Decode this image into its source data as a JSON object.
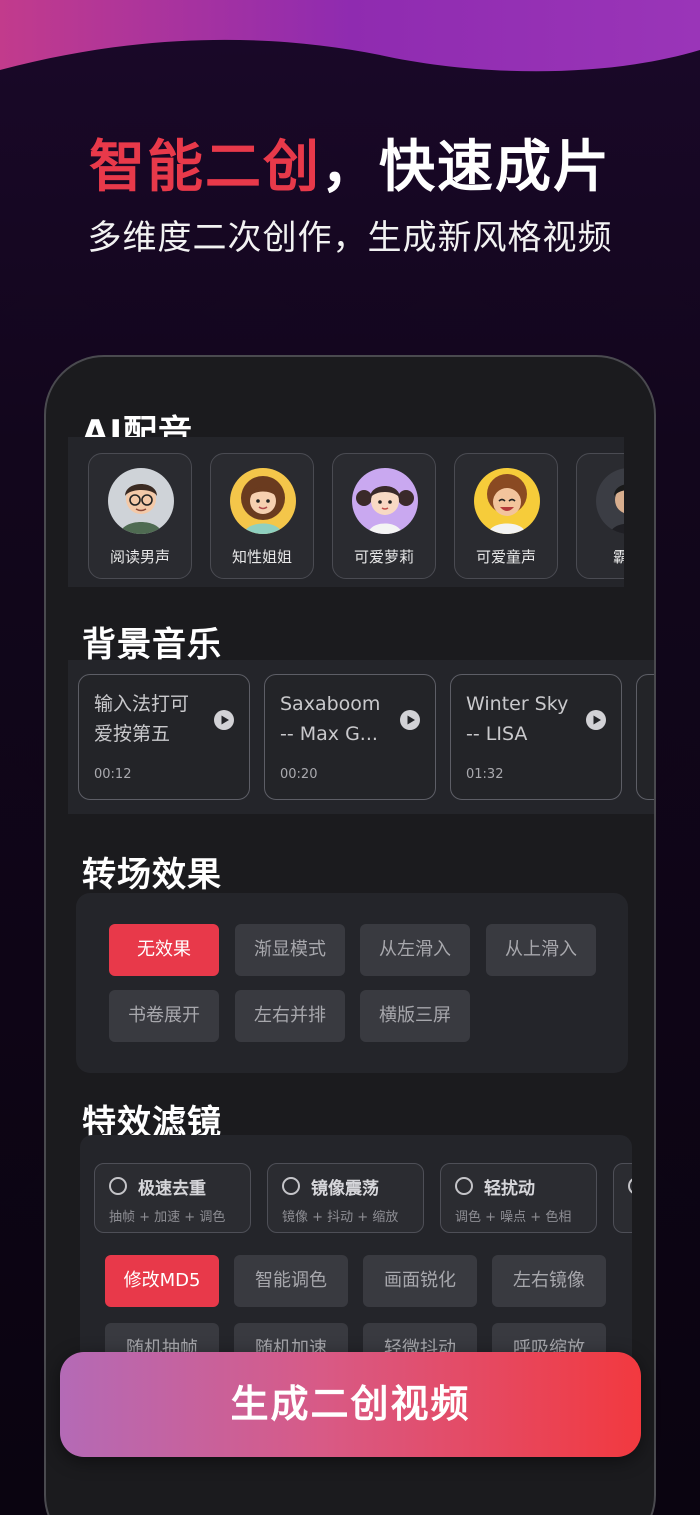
{
  "colors": {
    "accent": "#e8394a",
    "panel": "#24252a",
    "chip": "#393a40"
  },
  "hero": {
    "title_red": "智能二创",
    "title_white": "，快速成片",
    "subtitle": "多维度二次创作，生成新风格视频"
  },
  "voices": {
    "title": "AI配音",
    "items": [
      {
        "label": "阅读男声",
        "icon": "avatar-man-glasses"
      },
      {
        "label": "知性姐姐",
        "icon": "avatar-woman-curly"
      },
      {
        "label": "可爱萝莉",
        "icon": "avatar-girl-pigtails"
      },
      {
        "label": "可爱童声",
        "icon": "avatar-boy-curly"
      },
      {
        "label": "霸道",
        "icon": "avatar-man-dark"
      }
    ]
  },
  "music": {
    "title": "背景音乐",
    "items": [
      {
        "title": "输入法打可\n爱按第五",
        "time": "00:12"
      },
      {
        "title": "Saxaboom\n-- Max G...",
        "time": "00:20"
      },
      {
        "title": "Winter Sky\n-- LISA",
        "time": "01:32"
      }
    ]
  },
  "transitions": {
    "title": "转场效果",
    "items": [
      "无效果",
      "渐显模式",
      "从左滑入",
      "从上滑入",
      "书卷展开",
      "左右并排",
      "横版三屏"
    ],
    "selected": "无效果"
  },
  "filters": {
    "title": "特效滤镜",
    "presets": [
      {
        "name": "极速去重",
        "desc": "抽帧 + 加速 + 调色"
      },
      {
        "name": "镜像震荡",
        "desc": "镜像 + 抖动 + 缩放"
      },
      {
        "name": "轻扰动",
        "desc": "调色 + 噪点 + 色相"
      }
    ],
    "options": [
      "修改MD5",
      "智能调色",
      "画面锐化",
      "左右镜像",
      "随机抽帧",
      "随机加速",
      "轻微抖动",
      "呼吸缩放"
    ],
    "selected": "修改MD5"
  },
  "cta": {
    "label": "生成二创视频"
  }
}
